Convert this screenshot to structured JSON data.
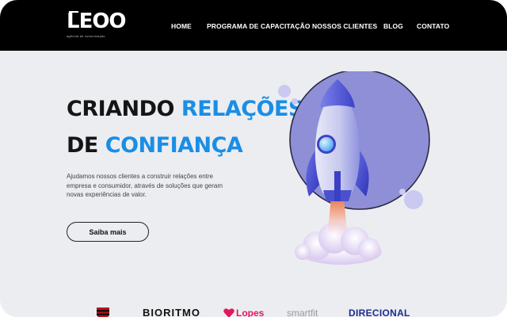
{
  "header": {
    "logo_text": "LEOO",
    "logo_tagline": "agência de comunicação",
    "nav": [
      {
        "label": "HOME"
      },
      {
        "label": "PROGRAMA DE CAPACITAÇÃO"
      },
      {
        "label": "NOSSOS CLIENTES"
      },
      {
        "label": "BLOG"
      },
      {
        "label": "CONTATO"
      }
    ]
  },
  "hero": {
    "title_line1_a": "CRIANDO",
    "title_line1_b": "RELAÇÕES",
    "title_line2_a": "DE",
    "title_line2_b": "CONFIANÇA",
    "description": "Ajudamos nossos clientes a construir relações entre empresa e consumidor, através de soluções que geram novas experiências de valor.",
    "cta_label": "Saiba mais"
  },
  "clients": {
    "logos": [
      "BIORITMO",
      "Lopes",
      "smartfit",
      "DIRECIONAL"
    ]
  },
  "colors": {
    "accent": "#1a8ee6",
    "nav_bg": "#000000",
    "page_bg": "#ecedf1",
    "rocket_purple": "#5b5fd6"
  },
  "icons": {
    "rocket": "rocket-illustration",
    "crest": "club-crest-icon",
    "heart": "heart-icon"
  }
}
